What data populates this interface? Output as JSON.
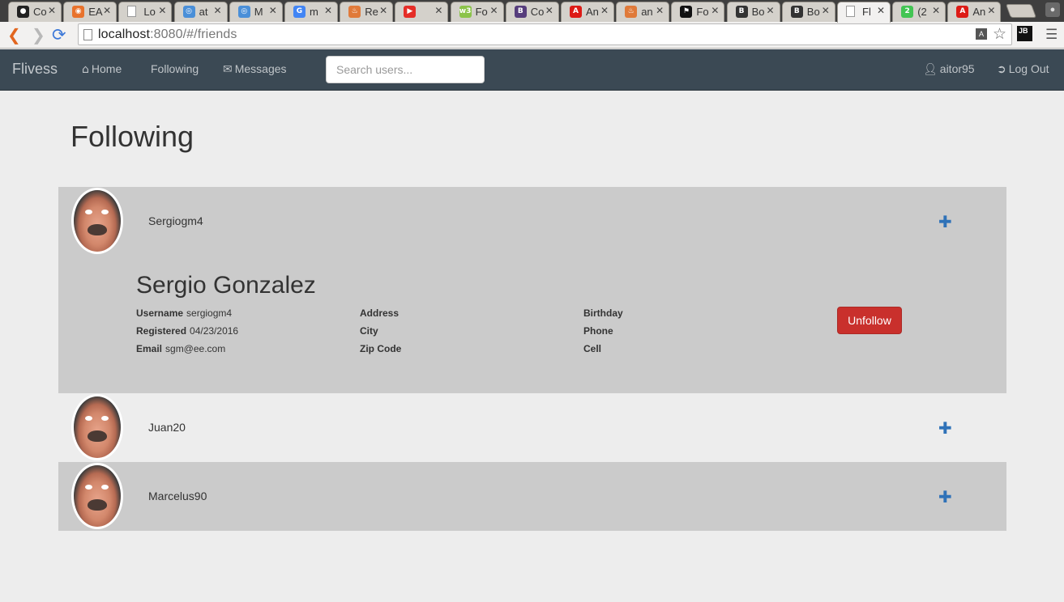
{
  "browser": {
    "tabs": [
      {
        "title": "Co",
        "icon": "github-icon",
        "color": "#222222"
      },
      {
        "title": "EA",
        "icon": "orange-circle-icon",
        "color": "#e8722c"
      },
      {
        "title": "Lo",
        "icon": "page-icon",
        "color": "#9a9a9a"
      },
      {
        "title": "at",
        "icon": "globe-icon",
        "color": "#4a8fd8"
      },
      {
        "title": "M",
        "icon": "globe-icon",
        "color": "#4a8fd8"
      },
      {
        "title": "m",
        "icon": "google-icon",
        "color": "#4285f4"
      },
      {
        "title": "Re",
        "icon": "flame-icon",
        "color": "#e07a3a"
      },
      {
        "title": "",
        "icon": "youtube-icon",
        "color": "#e52d27"
      },
      {
        "title": "Fo",
        "icon": "w3-icon",
        "color": "#8bc34a"
      },
      {
        "title": "Co",
        "icon": "bootstrap-icon",
        "color": "#563d7c"
      },
      {
        "title": "An",
        "icon": "angular-icon",
        "color": "#dd1b16"
      },
      {
        "title": "an",
        "icon": "flame-icon",
        "color": "#e07a3a"
      },
      {
        "title": "Fo",
        "icon": "flag-icon",
        "color": "#111111"
      },
      {
        "title": "Bo",
        "icon": "bootstrap-b-icon",
        "color": "#333333"
      },
      {
        "title": "Bo",
        "icon": "bootstrap-b-icon",
        "color": "#333333"
      },
      {
        "title": "Fl",
        "icon": "page-icon",
        "color": "#9a9a9a",
        "active": true
      },
      {
        "title": "(2",
        "icon": "whatsapp-icon",
        "color": "#43c553"
      },
      {
        "title": "An",
        "icon": "angular-icon",
        "color": "#dd1b16"
      }
    ],
    "url_host": "localhost",
    "url_rest": ":8080/#/friends",
    "extension_label": "JB"
  },
  "nav": {
    "brand": "Flivess",
    "home": "Home",
    "following": "Following",
    "messages": "Messages",
    "search_placeholder": "Search users...",
    "user": "aitor95",
    "logout": "Log Out"
  },
  "page": {
    "title": "Following"
  },
  "friends": [
    {
      "username": "Sergiogm4",
      "expanded": true,
      "full_name": "Sergio Gonzalez",
      "username_label": "Username",
      "username_value": "sergiogm4",
      "registered_label": "Registered",
      "registered_value": "04/23/2016",
      "email_label": "Email",
      "email_value": "sgm@ee.com",
      "address_label": "Address",
      "city_label": "City",
      "zip_label": "Zip Code",
      "birthday_label": "Birthday",
      "phone_label": "Phone",
      "cell_label": "Cell",
      "unfollow_label": "Unfollow"
    },
    {
      "username": "Juan20"
    },
    {
      "username": "Marcelus90"
    }
  ],
  "colors": {
    "navbar": "#3b4954",
    "shade_row": "#cbcbcb",
    "danger": "#c9302c",
    "plus_icon": "#2f72b8"
  }
}
